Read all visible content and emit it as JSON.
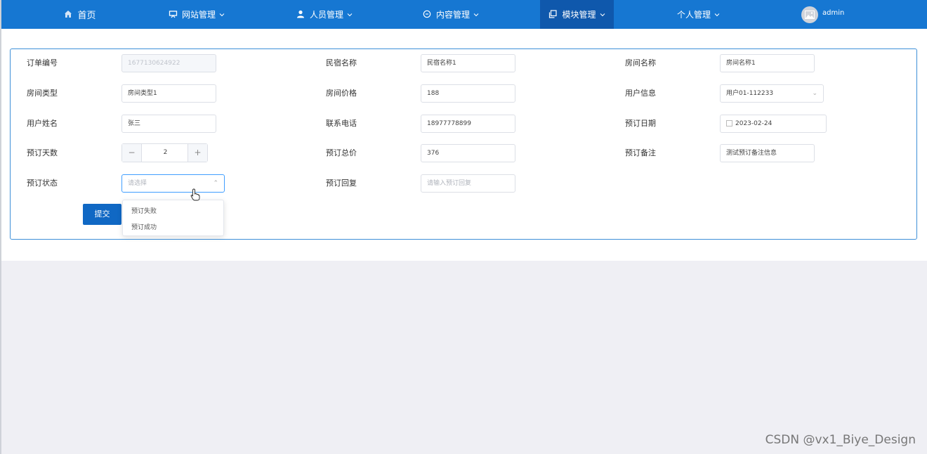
{
  "nav": {
    "home": "首页",
    "site": "网站管理",
    "staff": "人员管理",
    "content": "内容管理",
    "module": "模块管理",
    "personal": "个人管理",
    "user": "admin"
  },
  "form": {
    "order_no_label": "订单编号",
    "order_no_value": "1677130624922",
    "homestay_name_label": "民宿名称",
    "homestay_name_value": "民宿名称1",
    "room_name_label": "房间名称",
    "room_name_value": "房间名称1",
    "room_type_label": "房间类型",
    "room_type_value": "房间类型1",
    "room_price_label": "房间价格",
    "room_price_value": "188",
    "user_info_label": "用户信息",
    "user_info_value": "用户01-112233",
    "user_name_label": "用户姓名",
    "user_name_value": "张三",
    "phone_label": "联系电话",
    "phone_value": "18977778899",
    "date_label": "预订日期",
    "date_value": "2023-02-24",
    "days_label": "预订天数",
    "days_value": "2",
    "total_label": "预订总价",
    "total_value": "376",
    "remark_label": "预订备注",
    "remark_value": "测试预订备注信息",
    "status_label": "预订状态",
    "status_placeholder": "请选择",
    "reply_label": "预订回复",
    "reply_placeholder": "请输入预订回复",
    "submit_label": "提交",
    "status_options": [
      "预订失败",
      "预订成功"
    ]
  },
  "watermark": "CSDN @vx1_Biye_Design",
  "colors": {
    "nav_bg": "#1677d2",
    "nav_active": "#0f58ac",
    "submit_bg": "#1068c4",
    "focus_border": "#409eff"
  }
}
